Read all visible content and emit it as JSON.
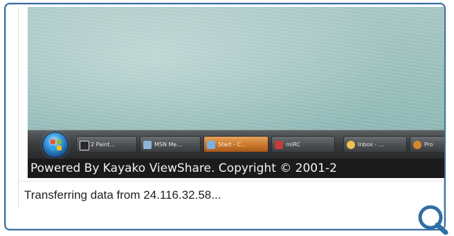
{
  "remote_screen": {
    "taskbar": {
      "start_icon": "windows-orb-icon",
      "tasks": [
        {
          "label": "2 Paint...",
          "icon": "paint-icon",
          "color": "#2b2b2b",
          "active": false
        },
        {
          "label": "MSN Me...",
          "icon": "msn-icon",
          "color": "#8fb3d9",
          "active": false
        },
        {
          "label": "Start - C...",
          "icon": "folder-icon",
          "color": "#7bb0e0",
          "active": true
        },
        {
          "label": "mIRC",
          "icon": "mirc-icon",
          "color": "#c43c3c",
          "active": false
        },
        {
          "label": "Inbox - ...",
          "icon": "mail-icon",
          "color": "#f0c050",
          "active": false
        },
        {
          "label": "Pro",
          "icon": "app-icon",
          "color": "#d9862b",
          "active": false
        }
      ]
    },
    "banner_text": "Powered By Kayako ViewShare. Copyright © 2001-2"
  },
  "status": {
    "text": "Transferring data from 24.116.32.58..."
  },
  "zoom_icon": "magnifier-icon"
}
